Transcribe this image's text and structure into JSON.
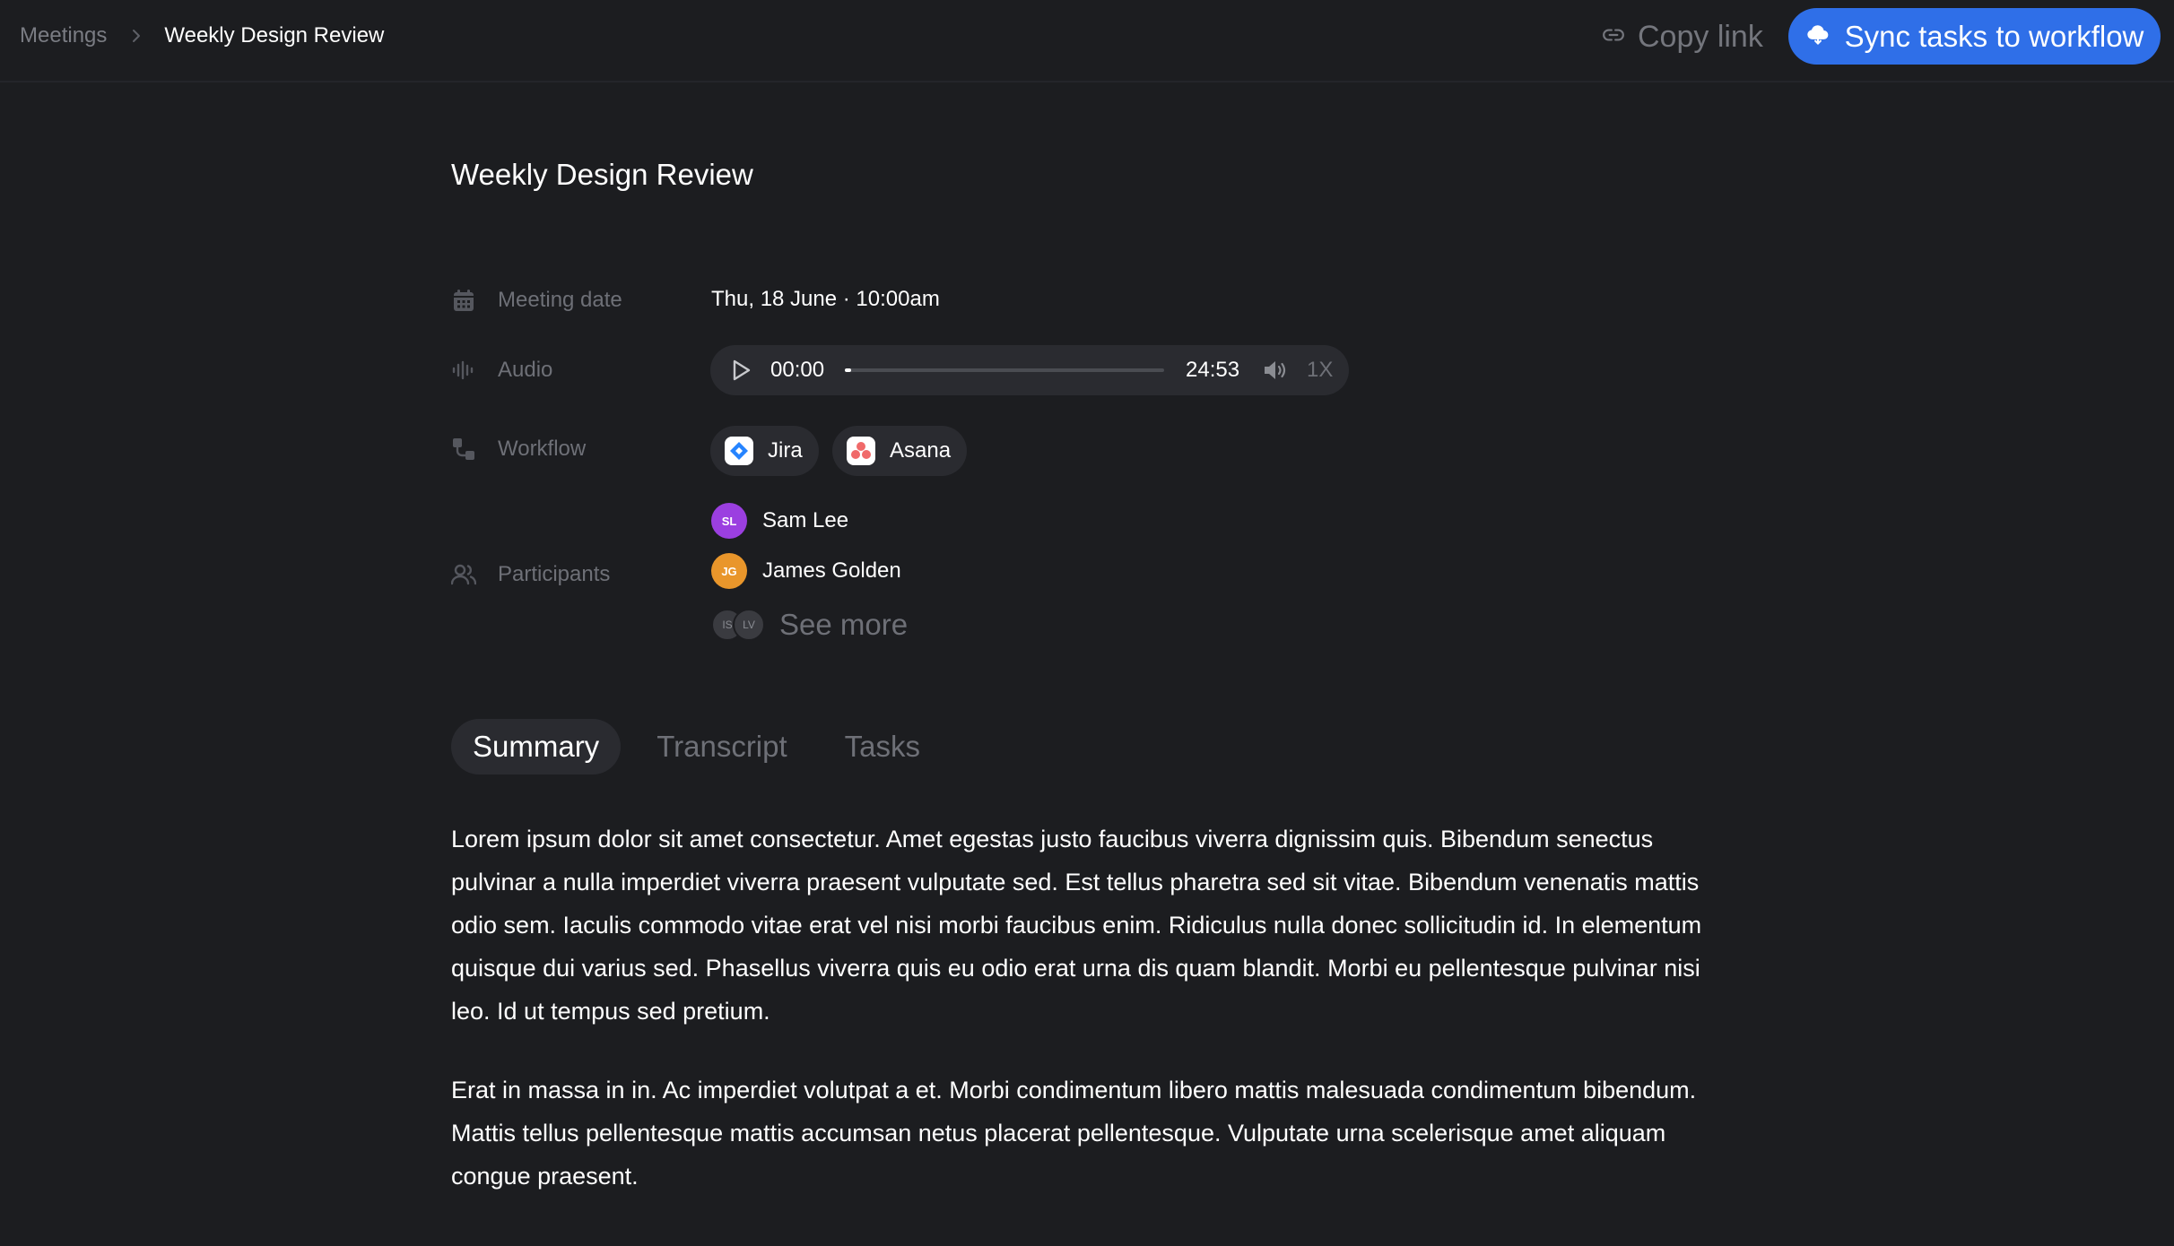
{
  "breadcrumb": {
    "parent": "Meetings",
    "current": "Weekly Design Review"
  },
  "header": {
    "copy_link_label": "Copy link",
    "sync_button_label": "Sync tasks to workflow"
  },
  "meeting": {
    "title": "Weekly Design Review",
    "labels": {
      "date": "Meeting date",
      "audio": "Audio",
      "workflow": "Workflow",
      "participants": "Participants"
    },
    "date_value": "Thu, 18 June · 10:00am",
    "audio": {
      "current_time": "00:00",
      "total_time": "24:53",
      "speed": "1X",
      "progress": 0.01
    },
    "workflows": [
      {
        "name": "Jira",
        "icon": "jira-logo"
      },
      {
        "name": "Asana",
        "icon": "asana-logo"
      }
    ],
    "participants": [
      {
        "initials": "SL",
        "name": "Sam Lee",
        "color": "#9b3fe0"
      },
      {
        "initials": "JG",
        "name": "James Golden",
        "color": "#e9962b"
      }
    ],
    "more_participants": [
      "IS",
      "LV"
    ],
    "see_more_label": "See more"
  },
  "tabs": [
    {
      "label": "Summary",
      "active": true
    },
    {
      "label": "Transcript",
      "active": false
    },
    {
      "label": "Tasks",
      "active": false
    }
  ],
  "summary": {
    "paragraphs": [
      "Lorem ipsum dolor sit amet consectetur. Amet egestas justo faucibus viverra dignissim quis. Bibendum senectus pulvinar a nulla imperdiet viverra praesent vulputate sed. Est tellus pharetra sed sit vitae. Bibendum venenatis mattis odio sem. Iaculis commodo vitae erat vel nisi morbi faucibus enim. Ridiculus nulla donec sollicitudin id. In elementum quisque dui varius sed. Phasellus viverra quis eu odio erat urna dis quam blandit. Morbi eu pellentesque pulvinar nisi leo. Id ut tempus sed pretium.",
      "Erat in massa in in. Ac imperdiet volutpat a et. Morbi condimentum libero mattis malesuada condimentum bibendum. Mattis tellus pellentesque mattis accumsan netus placerat pellentesque. Vulputate urna scelerisque amet aliquam congue praesent."
    ]
  },
  "colors": {
    "background": "#1c1d20",
    "accent": "#2f6fe8",
    "muted_text": "#6e7077",
    "chip_bg": "#2a2b30"
  }
}
